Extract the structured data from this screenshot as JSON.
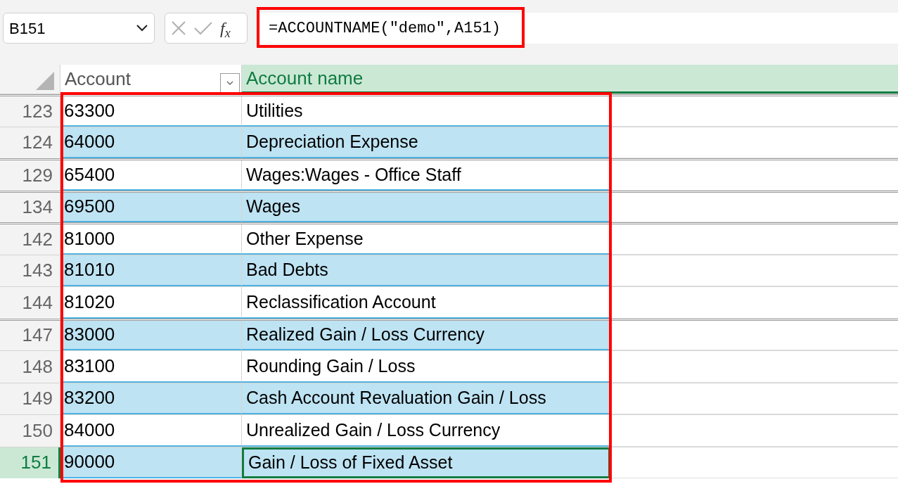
{
  "name_box": {
    "value": "B151"
  },
  "formula_bar": {
    "fx_label": "f$_{x}$",
    "value": "=ACCOUNTNAME(\"demo\",A151)"
  },
  "columns": [
    {
      "label": "Account",
      "filter": true,
      "selected": false
    },
    {
      "label": "Account name",
      "filter": false,
      "selected": true
    }
  ],
  "rows": [
    {
      "number": "123",
      "account": "63300",
      "name": "Utilities",
      "selected": false,
      "hidden_above": true
    },
    {
      "number": "124",
      "account": "64000",
      "name": "Depreciation Expense",
      "selected": false,
      "hidden_above": false
    },
    {
      "number": "129",
      "account": "65400",
      "name": "Wages:Wages - Office Staff",
      "selected": false,
      "hidden_above": true
    },
    {
      "number": "134",
      "account": "69500",
      "name": "Wages",
      "selected": false,
      "hidden_above": true
    },
    {
      "number": "142",
      "account": "81000",
      "name": "Other Expense",
      "selected": false,
      "hidden_above": true
    },
    {
      "number": "143",
      "account": "81010",
      "name": "Bad Debts",
      "selected": false,
      "hidden_above": false
    },
    {
      "number": "144",
      "account": "81020",
      "name": "Reclassification Account",
      "selected": false,
      "hidden_above": false
    },
    {
      "number": "147",
      "account": "83000",
      "name": "Realized Gain / Loss Currency",
      "selected": false,
      "hidden_above": true
    },
    {
      "number": "148",
      "account": "83100",
      "name": "Rounding Gain / Loss",
      "selected": false,
      "hidden_above": false
    },
    {
      "number": "149",
      "account": "83200",
      "name": "Cash Account Revaluation Gain / Loss",
      "selected": false,
      "hidden_above": false
    },
    {
      "number": "150",
      "account": "84000",
      "name": "Unrealized Gain / Loss Currency",
      "selected": false,
      "hidden_above": false
    },
    {
      "number": "151",
      "account": "90000",
      "name": "Gain / Loss of Fixed Asset",
      "selected": true,
      "hidden_above": false
    }
  ]
}
